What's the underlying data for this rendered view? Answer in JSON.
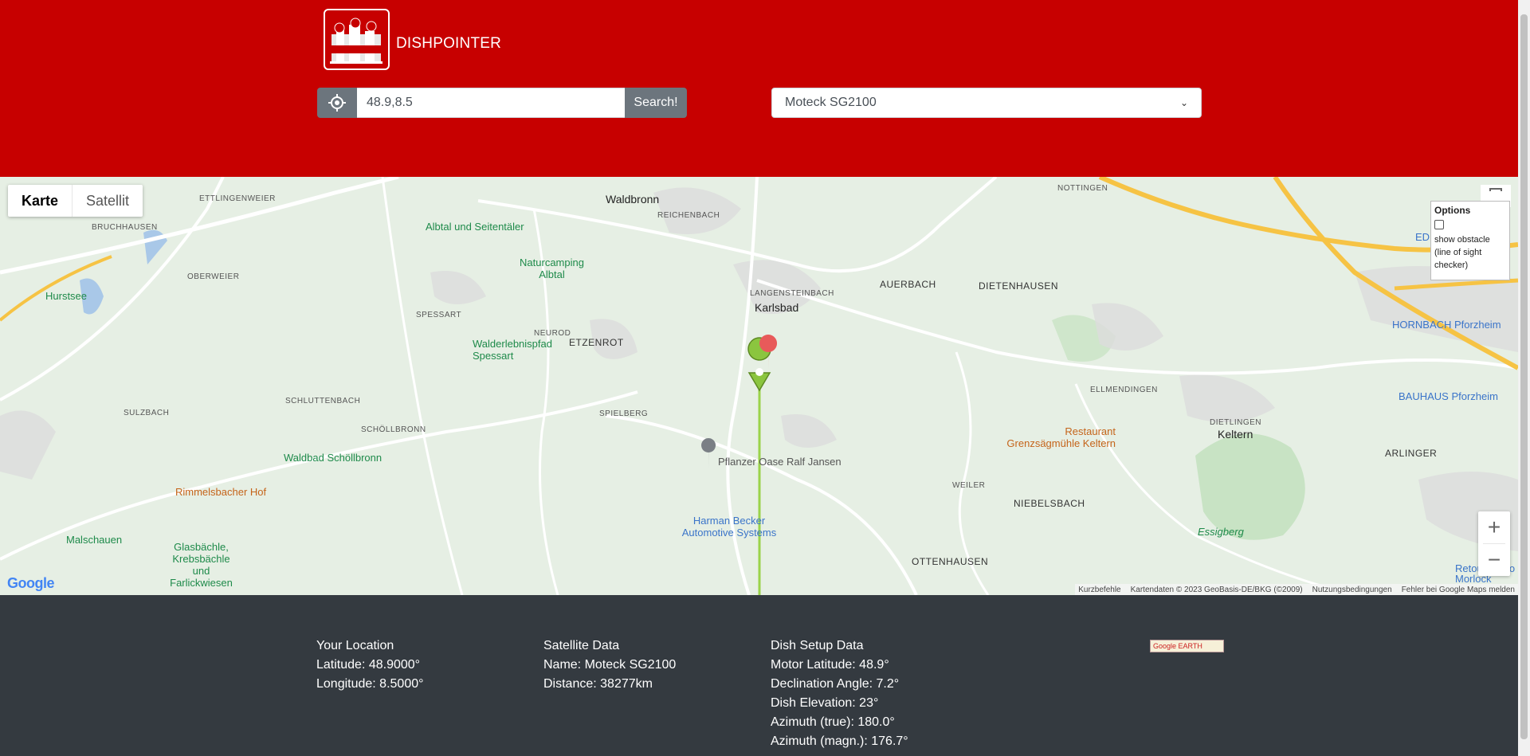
{
  "header": {
    "brand": "DISHPOINTER",
    "search_value": "48.9,8.5",
    "search_button": "Search!",
    "satellite_select": "Moteck SG2100"
  },
  "map": {
    "tabs": [
      "Karte",
      "Satellit"
    ],
    "options": {
      "title": "Options",
      "checkbox_label": "show obstacle (line of sight checker)"
    },
    "places": {
      "waldbronn": "Waldbronn",
      "reichenbach": "REICHENBACH",
      "ettlingenweier": "ETTLINGENWEIER",
      "bruchhausen": "BRUCHHAUSEN",
      "oberweier": "OBERWEIER",
      "hurstsee": "Hurstsee",
      "albtal": "Albtal und Seitentäler",
      "naturcamping": "Naturcamping Albtal",
      "spessart": "SPESSART",
      "etzenrot": "ETZENROT",
      "neurod": "NEUROD",
      "walderlebnispfad": "Walderlebnispfad Spessart",
      "langensteinbach": "LANGENSTEINBACH",
      "karlsbad": "Karlsbad",
      "auerbach": "AUERBACH",
      "dietenhausen": "DIETENHAUSEN",
      "nottingen": "NOTTINGEN",
      "hornbach": "HORNBACH Pforzheim",
      "bauhaus": "BAUHAUS Pforzheim",
      "ellmendingen": "ELLMENDINGEN",
      "dietlingen": "DIETLINGEN",
      "keltern": "Keltern",
      "arlinger": "ARLINGER",
      "restaurant": "Restaurant Grenzsägmühle Keltern",
      "schluttenbach": "SCHLUTTENBACH",
      "sulzbach": "SULZBACH",
      "schoellbronn": "SCHÖLLBRONN",
      "waldbad": "Waldbad Schöllbronn",
      "rimmelsbacher": "Rimmelsbacher Hof",
      "spielberg": "SPIELBERG",
      "pflanzer": "Pflanzer Oase Ralf Jansen",
      "harman": "Harman Becker Automotive Systems",
      "weiler": "WEILER",
      "niebelsbach": "NIEBELSBACH",
      "ottenhausen": "OTTENHAUSEN",
      "essigberg": "Essigberg",
      "malschauen": "Malschauen",
      "glasbaechle": "Glasbächle, Krebsbächle und Farlickwiesen",
      "retour": "Retoure Ingo Morlock",
      "ede": "EDE"
    },
    "attribution": [
      "Kurzbefehle",
      "Kartendaten © 2023 GeoBasis-DE/BKG (©2009)",
      "Nutzungsbedingungen",
      "Fehler bei Google Maps melden"
    ],
    "google_logo": "Google"
  },
  "footer": {
    "location": {
      "title": "Your Location",
      "latitude": "Latitude: 48.9000°",
      "longitude": "Longitude: 8.5000°"
    },
    "satellite": {
      "title": "Satellite Data",
      "name": "Name: Moteck SG2100",
      "distance": "Distance: 38277km"
    },
    "dish": {
      "title": "Dish Setup Data",
      "motor_latitude": "Motor Latitude:  48.9°",
      "declination": "Declination Angle:  7.2°",
      "elevation": "Dish Elevation:  23°",
      "azimuth_true": "Azimuth (true):  180.0°",
      "azimuth_magn": "Azimuth (magn.):  176.7°"
    },
    "google_earth": "Google EARTH"
  }
}
